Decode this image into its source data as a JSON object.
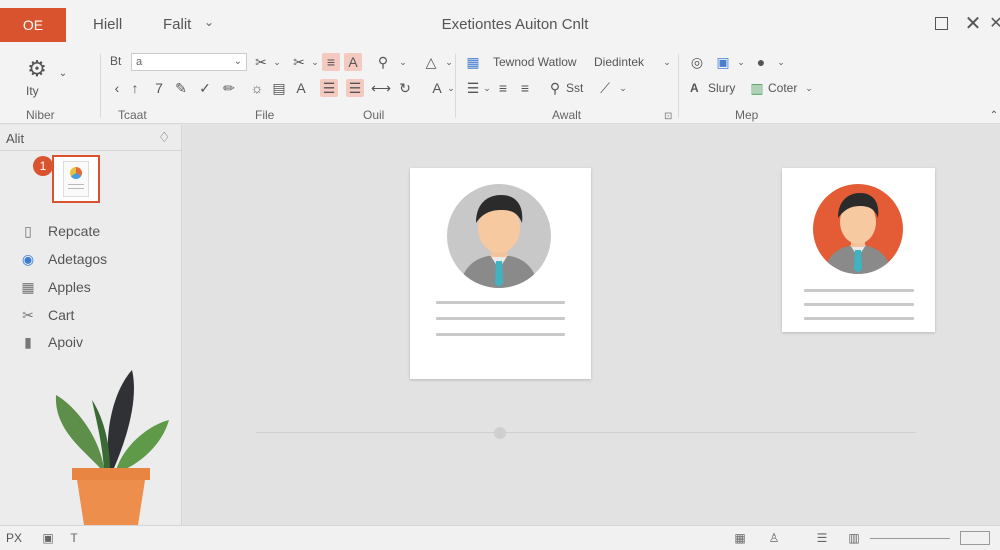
{
  "app": {
    "badge": "OE",
    "menus": [
      "Hiell",
      "Falit"
    ],
    "document_title": "Exetiontes Auiton Cnlt"
  },
  "ribbon": {
    "font_box_value": "a",
    "font_prefix": "Bt",
    "groups": [
      "Niber",
      "Tcaat",
      "File",
      "Ouil",
      "Awalt",
      "Mep"
    ],
    "big_button_label": "Ity",
    "command_labels": {
      "tewnod_wallow": "Tewnod Watlow",
      "diedintek": "Diedintek",
      "set": "Sst",
      "slury": "Slury",
      "coter": "Coter",
      "a_label": "A"
    },
    "icons": {
      "gear": "gear-icon",
      "cut": "scissors-icon",
      "align": "align-icon",
      "font_color": "font-color-icon"
    },
    "highlight_color": "#f4c9bf"
  },
  "left_pane": {
    "title": "Alit",
    "badge_number": "1",
    "items": [
      {
        "label": "Repcate",
        "icon": "book-icon"
      },
      {
        "label": "Adetagos",
        "icon": "drop-icon"
      },
      {
        "label": "Apples",
        "icon": "grid-icon"
      },
      {
        "label": "Cart",
        "icon": "cart-icon"
      },
      {
        "label": "Apoiv",
        "icon": "doc-icon"
      }
    ]
  },
  "canvas": {
    "cards": [
      {
        "avatar_bg": "#c8c8c8"
      },
      {
        "avatar_bg": "#e45c35"
      }
    ],
    "slider_value": 0.37
  },
  "status": {
    "left_text": "PX"
  },
  "colors": {
    "accent": "#d9532f",
    "background": "#e2e2e2"
  }
}
